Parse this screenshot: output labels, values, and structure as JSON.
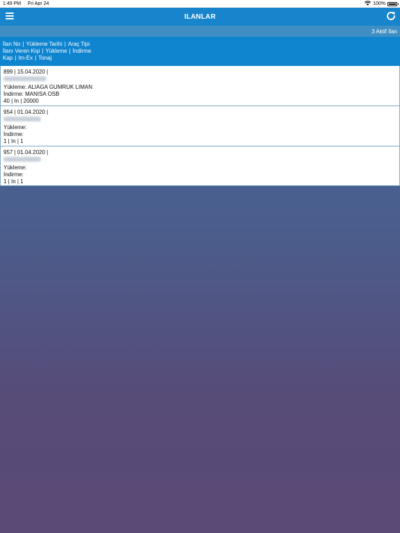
{
  "status": {
    "time": "1:49 PM",
    "date": "Fri Apr 24",
    "battery": "100%"
  },
  "nav": {
    "title": "ILANLAR",
    "menu_icon": "hamburger-icon",
    "refresh_icon": "refresh-icon"
  },
  "subbar": {
    "active_count": "3 Aktif İlan"
  },
  "legend": {
    "line1": [
      "İlan No",
      "Yükleme Tarihi",
      "Araç Tipi"
    ],
    "line2": [
      "İlanı Veren Kişi",
      "Yükleme",
      "İndirme"
    ],
    "line3": [
      "Kap",
      "Im-Ex",
      "Tonaj"
    ]
  },
  "listings": [
    {
      "header": "899 | 15.04.2020 |",
      "loading": "Yükleme: ALIAGA GUMRUK LIMAN",
      "unloading": "İndirme: MANISA OSB",
      "footer": "40 | In | 20000"
    },
    {
      "header": "954 | 01.04.2020 |",
      "loading": "Yükleme:",
      "unloading": "İndirme:",
      "footer": "1 | In | 1"
    },
    {
      "header": "957 | 01.04.2020 |",
      "loading": "Yükleme:",
      "unloading": "İndirme:",
      "footer": "1 | In | 1"
    }
  ]
}
